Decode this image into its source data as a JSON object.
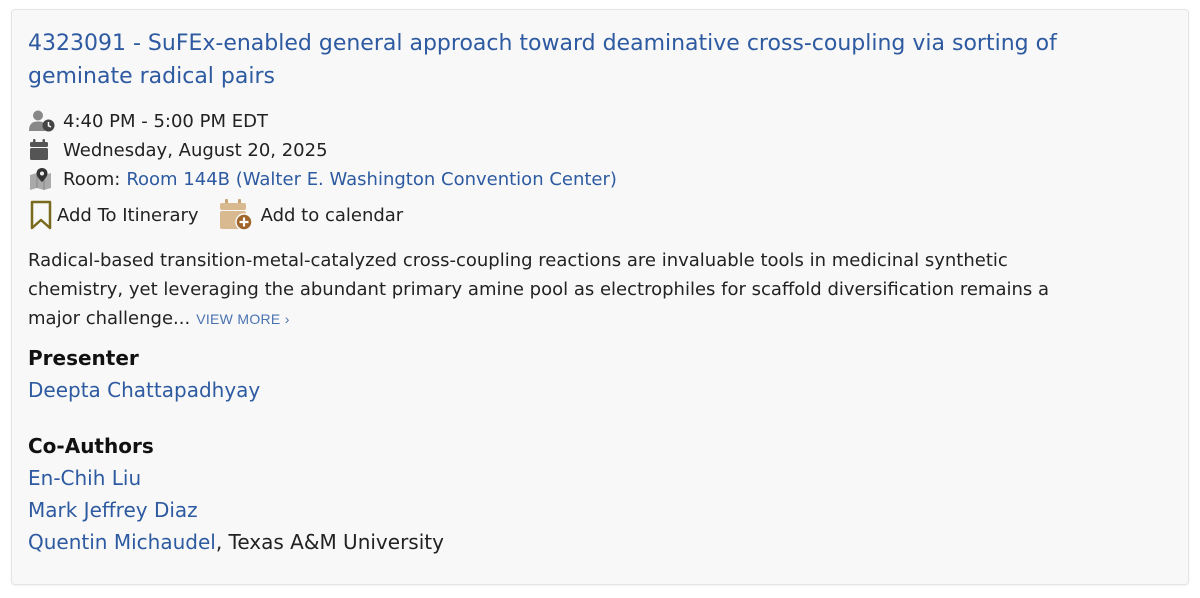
{
  "session": {
    "title": "4323091 - SuFEx-enabled general approach toward deaminative cross-coupling via sorting of geminate radical pairs",
    "time": "4:40 PM - 5:00 PM EDT",
    "date": "Wednesday, August 20, 2025",
    "room_label": "Room:",
    "room": "Room 144B (Walter E. Washington Convention Center)"
  },
  "icons": {
    "time": "person-clock-icon",
    "date": "calendar-icon",
    "room": "map-pin-icon",
    "itinerary": "bookmark-icon",
    "calendar": "calendar-add-icon"
  },
  "actions": {
    "itinerary": "Add To Itinerary",
    "calendar": "Add to calendar"
  },
  "abstract": {
    "text": "Radical-based transition-metal-catalyzed cross-coupling reactions are invaluable tools in medicinal synthetic chemistry, yet leveraging the abundant primary amine pool as electrophiles for scaffold diversification remains a major challenge...",
    "view_more": "VIEW MORE ›"
  },
  "presenter": {
    "heading": "Presenter",
    "name": "Deepta Chattapadhyay"
  },
  "coauthors": {
    "heading": "Co-Authors",
    "list": [
      {
        "name": "En-Chih Liu",
        "affiliation": ""
      },
      {
        "name": "Mark Jeffrey Diaz",
        "affiliation": ""
      },
      {
        "name": "Quentin Michaudel",
        "affiliation": ", Texas A&M University"
      }
    ]
  },
  "colors": {
    "link": "#2d5aa0",
    "text": "#222222",
    "card_bg": "#f8f8f8",
    "bookmark": "#7a6a1e",
    "calendar_icon": "#d9b98f"
  }
}
